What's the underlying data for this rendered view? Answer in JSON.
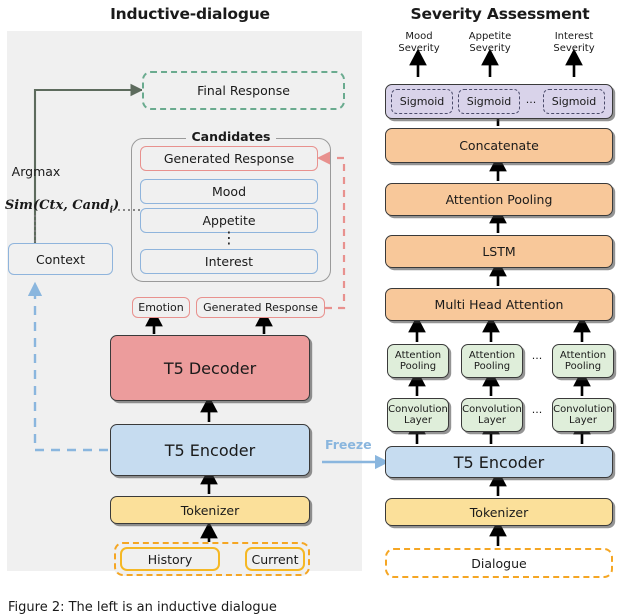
{
  "figure": {
    "left_title": "Inductive-dialogue",
    "right_title": "Severity Assessment",
    "caption": "Figure 2: The left is an inductive dialogue"
  },
  "left_panel": {
    "final_response": "Final Response",
    "argmax_label": "Argmax",
    "similarity_formula": "Sim(Ctx, Cand",
    "similarity_formula_sub": "i",
    "similarity_formula_end": ")",
    "context": "Context",
    "candidates_legend": "Candidates",
    "candidates": [
      {
        "label": "Generated Response",
        "style": "red"
      },
      {
        "label": "Mood",
        "style": "blue"
      },
      {
        "label": "Appetite",
        "style": "blue"
      },
      {
        "label": "Interest",
        "style": "blue"
      }
    ],
    "candidates_ellipsis": "⋮",
    "outputs": [
      {
        "label": "Emotion"
      },
      {
        "label": "Generated Response"
      }
    ],
    "t5_decoder": "T5 Decoder",
    "t5_encoder": "T5 Encoder",
    "tokenizer": "Tokenizer",
    "inputs": [
      "History",
      "Current"
    ]
  },
  "right_panel": {
    "severity_outputs": [
      {
        "line1": "Mood",
        "line2": "Severity"
      },
      {
        "line1": "Appetite",
        "line2": "Severity"
      },
      {
        "line1": "Interest",
        "line2": "Severity"
      }
    ],
    "sigmoids": [
      "Sigmoid",
      "Sigmoid",
      "Sigmoid"
    ],
    "sigmoid_ellipsis": "···",
    "concatenate": "Concatenate",
    "attention_pooling": "Attention Pooling",
    "lstm": "LSTM",
    "multi_head_attention": "Multi Head Attention",
    "branch_attention_pooling": {
      "line1": "Attention",
      "line2": "Pooling"
    },
    "branch_convolution": {
      "line1": "Convolution",
      "line2": "Layer"
    },
    "branch_ellipsis": "···",
    "t5_encoder": "T5 Encoder",
    "tokenizer": "Tokenizer",
    "dialogue": "Dialogue"
  },
  "connectors": {
    "freeze_label": "Freeze"
  },
  "colors": {
    "orange": "#f8c89a",
    "blue": "#c6dcf0",
    "yellow": "#fbe09a",
    "red": "#ec9c9c",
    "green": "#dfeeda",
    "purple": "#d9d3ea",
    "dashed_green": "#6aab8f",
    "dashed_yellow": "#f5a623",
    "dashed_red": "#e8918e",
    "freeze_blue": "#8ab6de",
    "panel_bg": "#f0f0f0"
  }
}
